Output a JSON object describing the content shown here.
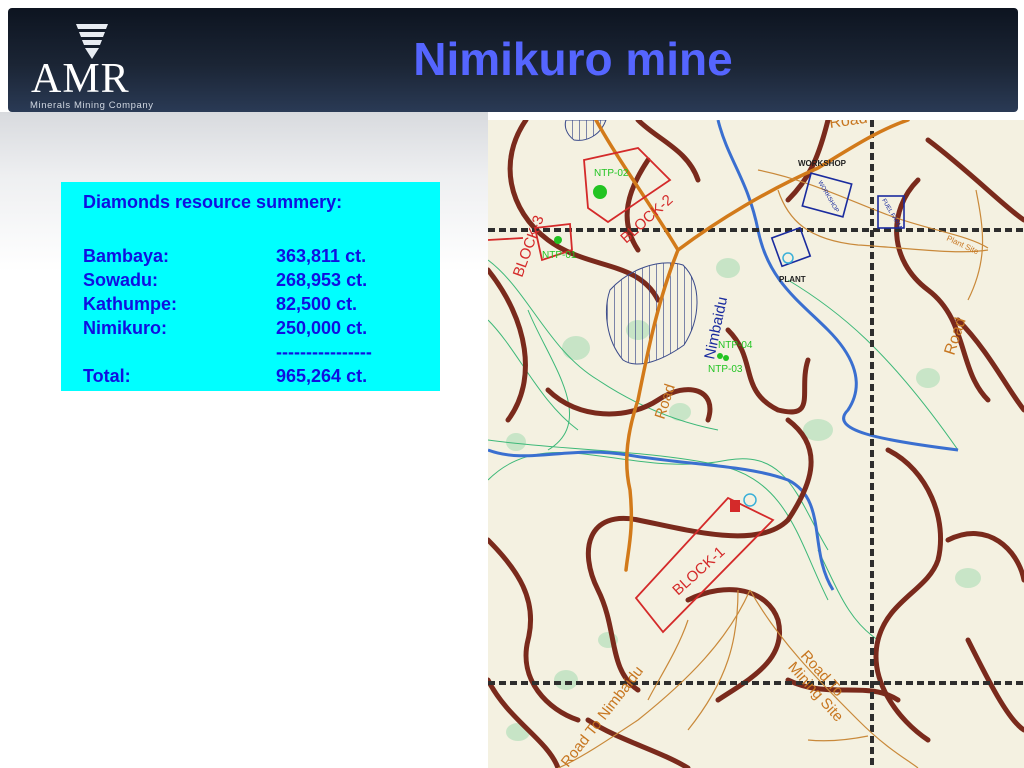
{
  "header": {
    "title": "Nimikuro mine",
    "logo": {
      "wordmark": "AMR",
      "tagline": "Minerals Mining Company",
      "icon": "drill-bit-icon"
    }
  },
  "summary": {
    "heading": "Diamonds resource summery:",
    "rows": [
      {
        "label": "Bambaya:",
        "value": "363,811 ct."
      },
      {
        "label": "Sowadu:",
        "value": "268,953 ct."
      },
      {
        "label": "Kathumpe:",
        "value": "82,500 ct."
      },
      {
        "label": "Nimikuro:",
        "value": "250,000 ct."
      },
      {
        "label": "",
        "value": "----------------"
      },
      {
        "label": "Total:",
        "value": "965,264 ct."
      }
    ]
  },
  "map": {
    "labels": {
      "road_top": "Road",
      "road_right": "Road",
      "road_center": "Road",
      "workshop": "WORKSHOP",
      "workshop_box": "WORKSHOP",
      "fuel_farm": "FUEL FARM",
      "plant_site": "Plant Site",
      "plant": "PLANT",
      "block_1": "BLOCK-1",
      "block_2": "BLOCK-2",
      "block_3": "BLOCK-3",
      "ntp_02": "NTP-02",
      "ntp_01": "NTP-01",
      "ntp_04": "NTP-04",
      "ntp_03": "NTP-03",
      "river": "Nimbaidu",
      "road_mining": "Road To\nMining Site",
      "road_nimbaidu": "Road To Nimbaidu"
    },
    "colors": {
      "background": "#f4f1e1",
      "contour": "#7a2a1c",
      "grid_line": "#2e2e2e",
      "river": "#3a6fd0",
      "river_band": "#3cb878",
      "haul_road": "#d27a1a",
      "mine_block": "#d42a2a",
      "label_blue": "#1a2b9e",
      "sample_green": "#22c422",
      "vegetation": "#b9e0bd"
    }
  }
}
